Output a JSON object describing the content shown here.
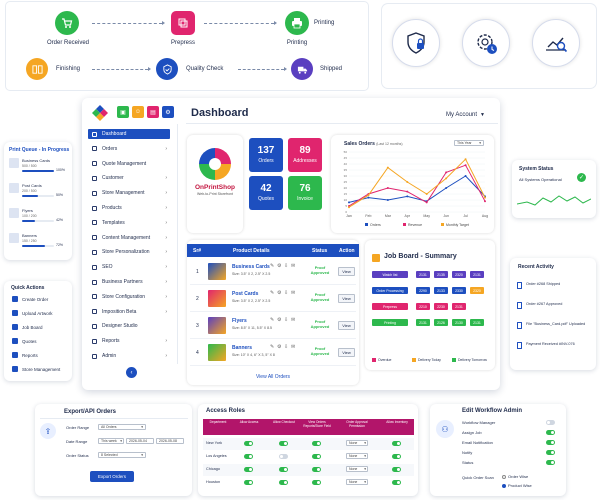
{
  "workflow": {
    "steps": [
      {
        "label": "Order Received",
        "color": "#2db84d",
        "icon": "cart-icon"
      },
      {
        "label": "Prepress",
        "color": "#e0256e",
        "icon": "layers-icon"
      },
      {
        "label": "Printing",
        "color": "#2db84d",
        "icon": "printer-icon"
      },
      {
        "label": "Finishing",
        "color": "#f5a623",
        "icon": "book-icon"
      },
      {
        "label": "Quality Check",
        "color": "#1d4fbf",
        "icon": "shield-check-icon"
      },
      {
        "label": "Shipped",
        "color": "#5a3fc0",
        "icon": "truck-icon"
      }
    ],
    "printing_label_top": "Printing"
  },
  "feature_icons": [
    "shield-lock-icon",
    "gear-clock-icon",
    "chart-search-icon"
  ],
  "print_queue": {
    "title": "Print Queue - In Progress",
    "items": [
      {
        "name": "Business Cards",
        "qty": "500 / 500",
        "pct": "100%",
        "progress": 100
      },
      {
        "name": "Post Cards",
        "qty": "200 / 500",
        "pct": "50%",
        "progress": 50
      },
      {
        "name": "Flyers",
        "qty": "100 / 200",
        "pct": "42%",
        "progress": 42
      },
      {
        "name": "Banners",
        "qty": "150 / 250",
        "pct": "72%",
        "progress": 72
      }
    ]
  },
  "quick_actions": {
    "title": "Quick Actions",
    "items": [
      "Create Order",
      "Upload Artwork",
      "Job Board",
      "Quotes",
      "Reports",
      "Store Management"
    ]
  },
  "dashboard": {
    "title": "Dashboard",
    "account": "My Account",
    "toolbar_colors": [
      "#2db84d",
      "#f5a623",
      "#e0256e",
      "#1d4fbf"
    ],
    "nav": [
      "Dashboard",
      "Orders",
      "Quote Management",
      "Customer",
      "Store Management",
      "Products",
      "Templates",
      "Content Management",
      "Store Personalization",
      "SEO",
      "Business Partners",
      "Store Configuration",
      "Imposition Beta",
      "Designer Studio",
      "Reports",
      "Admin"
    ],
    "logo_text": "OnPrintShop",
    "logo_sub": "Web-to-Print Storefront",
    "stats": [
      {
        "value": "137",
        "label": "Orders",
        "color": "#1d4fbf"
      },
      {
        "value": "89",
        "label": "Addresses",
        "color": "#e0256e"
      },
      {
        "value": "42",
        "label": "Quotes",
        "color": "#1d4fbf"
      },
      {
        "value": "76",
        "label": "Invoice",
        "color": "#2db84d"
      }
    ]
  },
  "sales_chart": {
    "title": "Sales Orders",
    "period_note": "(Last 12 months)",
    "filter": "This Year",
    "legend": [
      "Orders",
      "Revenue",
      "Monthly Target"
    ],
    "colors": [
      "#1d4fbf",
      "#e0256e",
      "#f5a623"
    ]
  },
  "chart_data": {
    "type": "line",
    "title": "Sales Orders",
    "categories": [
      "Jan",
      "Feb",
      "Mar",
      "Apr",
      "May",
      "Jun",
      "Jul",
      "Aug"
    ],
    "ylim": [
      0,
      50
    ],
    "yticks": [
      0,
      5,
      10,
      15,
      20,
      25,
      30,
      35,
      40,
      45,
      50
    ],
    "series": [
      {
        "name": "Orders",
        "values": [
          8,
          12,
          10,
          13,
          9,
          20,
          30,
          13
        ]
      },
      {
        "name": "Revenue",
        "values": [
          5,
          15,
          20,
          17,
          8,
          33,
          39,
          9
        ]
      },
      {
        "name": "Monthly Target",
        "values": [
          4,
          14,
          37,
          25,
          15,
          28,
          44,
          12
        ]
      }
    ]
  },
  "system_status": {
    "title": "System Status",
    "text": "All Systems Operational"
  },
  "orders_table": {
    "headers": [
      "Sr#",
      "Product Details",
      "Status",
      "Action"
    ],
    "rows": [
      {
        "sr": "1",
        "name": "Business Cards",
        "detail": "Size: 3.5\" X 2, 2.5\" X 2.5",
        "status": "Proof Approved",
        "action": "View"
      },
      {
        "sr": "2",
        "name": "Post Cards",
        "detail": "Size: 3.5\" X 2, 2.5\" X 2.5",
        "status": "Proof Approved",
        "action": "View"
      },
      {
        "sr": "3",
        "name": "Flyers",
        "detail": "Size: 8.5\" X 11, 5.5\" X 8.5",
        "status": "Proof Approved",
        "action": "View"
      },
      {
        "sr": "4",
        "name": "Banners",
        "detail": "Size: 10\" X 4, 6\" X 3, 5\" X 8",
        "status": "Proof Approved",
        "action": "View"
      }
    ],
    "view_all": "View All Orders"
  },
  "job_board": {
    "title": "Job Board - Summary",
    "rows": [
      {
        "label": "Watch list",
        "label_color": "#5a3fc0",
        "cells": [
          {
            "v": "2131",
            "c": "#5a3fc0"
          },
          {
            "v": "2135",
            "c": "#5a3fc0"
          },
          {
            "v": "2320",
            "c": "#5a3fc0"
          },
          {
            "v": "2131",
            "c": "#5a3fc0"
          }
        ]
      },
      {
        "label": "Order Processing",
        "label_color": "#1d4fbf",
        "cells": [
          {
            "v": "2290",
            "c": "#1d4fbf"
          },
          {
            "v": "2133",
            "c": "#1d4fbf"
          },
          {
            "v": "2330",
            "c": "#1d4fbf"
          },
          {
            "v": "2320",
            "c": "#f5a623"
          }
        ]
      },
      {
        "label": "Prepress",
        "label_color": "#e0256e",
        "cells": [
          {
            "v": "2210",
            "c": "#e0256e"
          },
          {
            "v": "2230",
            "c": "#e0256e"
          },
          {
            "v": "2131",
            "c": "#e0256e"
          },
          {
            "v": "",
            "c": "#ffffff"
          }
        ]
      },
      {
        "label": "Printing",
        "label_color": "#2db84d",
        "cells": [
          {
            "v": "2131",
            "c": "#2db84d"
          },
          {
            "v": "2126",
            "c": "#2db84d"
          },
          {
            "v": "2130",
            "c": "#2db84d"
          },
          {
            "v": "2131",
            "c": "#2db84d"
          }
        ]
      }
    ],
    "legend": [
      {
        "label": "Overdue",
        "color": "#e0256e"
      },
      {
        "label": "Delivery Today",
        "color": "#f5a623"
      },
      {
        "label": "Delivery Tomorrow",
        "color": "#2db84d"
      }
    ]
  },
  "recent_activity": {
    "title": "Recent Activity",
    "items": [
      "Order #268 Shipped",
      "Order #267 Approved",
      "File \"Business_Card.pdf\" Uploaded",
      "Payment Received #INV-076"
    ]
  },
  "export": {
    "title": "Export/API Orders",
    "fields": [
      {
        "label": "Order Range",
        "value": "All Orders"
      },
      {
        "label": "Date Range",
        "value": "This week",
        "from": "2026-05-04",
        "to": "2026-05-08"
      },
      {
        "label": "Order Status",
        "value": "8 Selected"
      }
    ],
    "button": "Export Orders"
  },
  "access_roles": {
    "title": "Access Roles",
    "headers": [
      "Department",
      "Allow Access",
      "Allow Checkout",
      "View Orders Reports/Store Field",
      "Order Approval Permission",
      "Allow Inventory"
    ],
    "rows": [
      {
        "name": "New York",
        "toggles": [
          true,
          true,
          true
        ],
        "sel": "None",
        "inv": true
      },
      {
        "name": "Los Angeles",
        "toggles": [
          true,
          false,
          true
        ],
        "sel": "None",
        "inv": true
      },
      {
        "name": "Chicago",
        "toggles": [
          true,
          true,
          true
        ],
        "sel": "None",
        "inv": true
      },
      {
        "name": "Houston",
        "toggles": [
          true,
          true,
          true
        ],
        "sel": "None",
        "inv": true
      }
    ]
  },
  "workflow_admin": {
    "title": "Edit Workflow Admin",
    "items": [
      {
        "label": "Workflow Manager",
        "on": false
      },
      {
        "label": "Assign Job",
        "on": true
      },
      {
        "label": "Email Notification",
        "on": true
      },
      {
        "label": "Notify",
        "on": true
      },
      {
        "label": "Status",
        "on": true
      }
    ],
    "quick_order_scan": "Quick Order Scan",
    "options": [
      "Order Wise",
      "Product Wise"
    ]
  }
}
